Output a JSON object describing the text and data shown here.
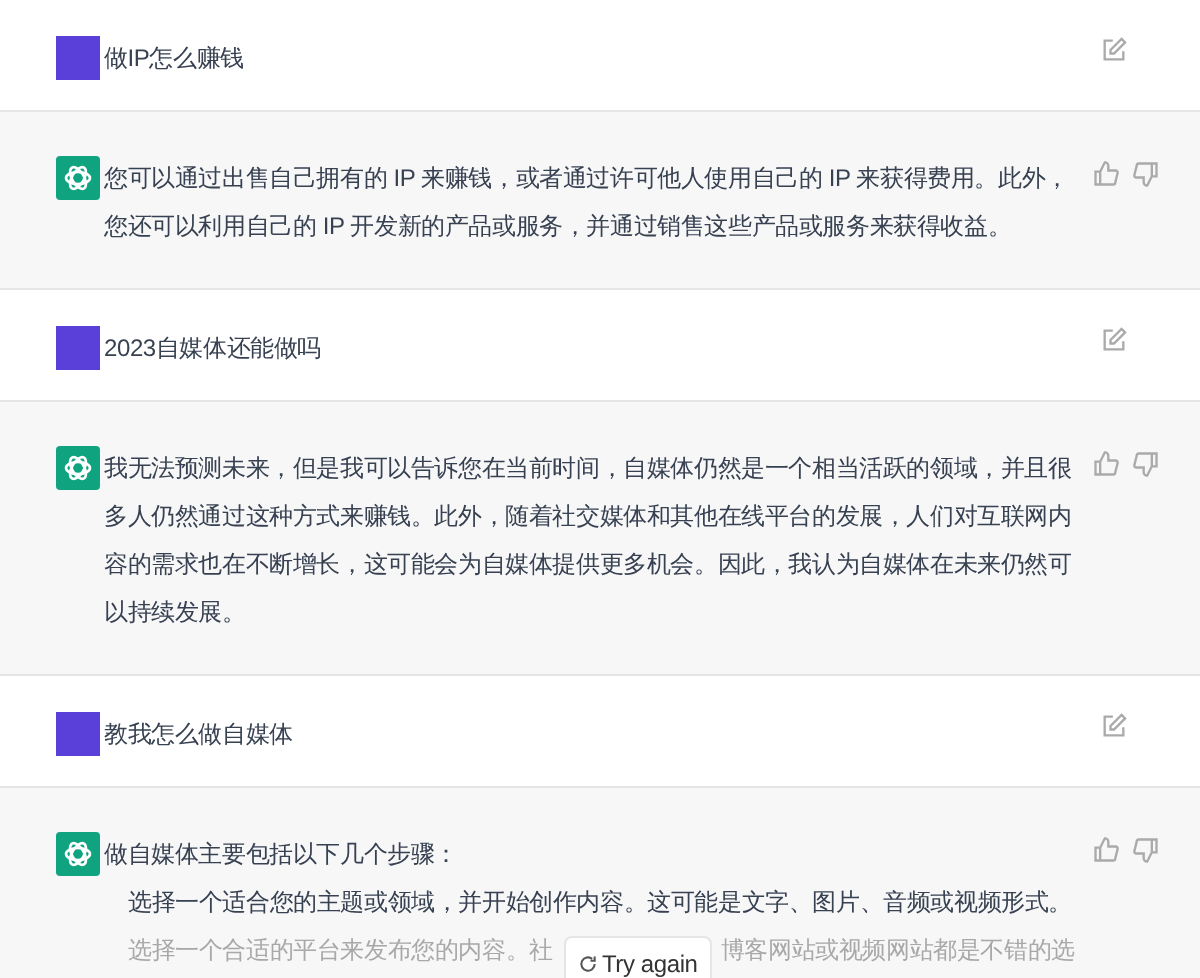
{
  "messages": [
    {
      "kind": "user",
      "text": "做IP怎么赚钱"
    },
    {
      "kind": "assistant",
      "paragraphs": [
        "您可以通过出售自己拥有的 IP 来赚钱，或者通过许可他人使用自己的 IP 来获得费用。此外，您还可以利用自己的 IP 开发新的产品或服务，并通过销售这些产品或服务来获得收益。"
      ]
    },
    {
      "kind": "user",
      "text": "2023自媒体还能做吗"
    },
    {
      "kind": "assistant",
      "paragraphs": [
        "我无法预测未来，但是我可以告诉您在当前时间，自媒体仍然是一个相当活跃的领域，并且很多人仍然通过这种方式来赚钱。此外，随着社交媒体和其他在线平台的发展，人们对互联网内容的需求也在不断增长，这可能会为自媒体提供更多机会。因此，我认为自媒体在未来仍然可以持续发展。"
      ]
    },
    {
      "kind": "user",
      "text": "教我怎么做自媒体"
    },
    {
      "kind": "assistant",
      "paragraphs": [
        "做自媒体主要包括以下几个步骤："
      ],
      "steps": [
        "选择一个适合您的主题或领域，并开始创作内容。这可能是文字、图片、音频或视频形式。"
      ],
      "faded_line": [
        "选择一个合适的平台来发布您的内容。社",
        "博客网站或视频网站都是不错的选"
      ]
    }
  ],
  "try_again": "Try again"
}
